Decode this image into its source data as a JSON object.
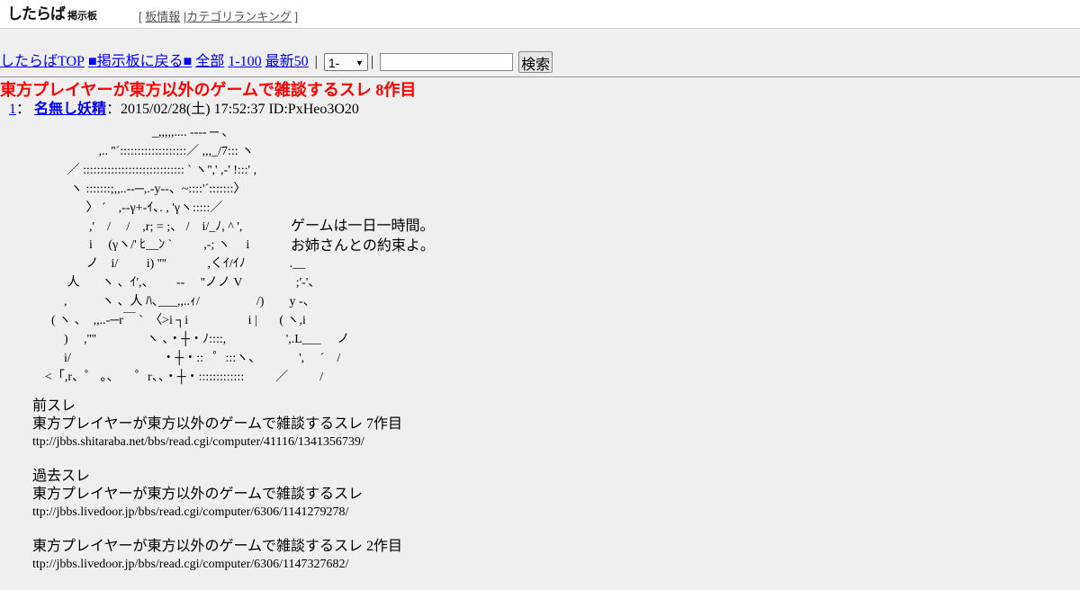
{
  "header": {
    "logo_main": "したらば",
    "logo_small": "掲示板",
    "bracket_open": "[",
    "bracket_close": "]",
    "link_board_info": "板情報",
    "divider": "|",
    "link_category_ranking": "カテゴリランキング"
  },
  "nav": {
    "top_link": "したらばTOP",
    "back_link": "■掲示板に戻る■",
    "all_link": "全部",
    "range_link": "1-100",
    "latest_link": "最新50",
    "pipe": "|",
    "select_value": "1-",
    "search_button": "検索"
  },
  "thread": {
    "title": "東方プレイヤーが東方以外のゲームで雑談するスレ 8作目"
  },
  "post": {
    "number": "1",
    "colon": "：",
    "name": "名無し妖精",
    "meta": "：2015/02/28(土) 17:52:37 ID:PxHeo3O20",
    "aa_lines": [
      "                                      _,,,,,.... ---- ─ ､",
      "                     ,.. ''´:::::::::::::::::::／ ,,,_/7::: ヽ",
      "           ／ ::::::::::::::::::::::::::::: ` ヽ'',' ,-' !:::' ,",
      "            ヽ :::::::;,,..--─,.-y--、~::::'´:::::::〉",
      "                 〉 ´    ,-‐γ+‐ｲ､. , 'γヽ:::::／",
      "                  ,'    /     /    ,r; = ;、 /    i/_ﾉ, ^ ',",
      "                  i     (γヽ/' ﾋ__ﾝ `          ,-; ヽ     i",
      "                 ノ    i/         i) ''''             ,くｲ/ｲﾉ              .__",
      "           人       ヽ 、ｲ',、       ‐-     ''ノノ V                 ;'-'、",
      "          ,           ヽ 、人 ﾊ､___,,..ｨ/                  /)        y -、",
      "      ( ヽ 、  ,,..-─r￣ `  〈>i ┐i                   i |       ( ヽ,i",
      "          )     ,''''                ヽ 、・┼・ﾉ::::,                   ',.L___     ノ",
      "          i/                             ・┼・::   ゜:::ヽ、            ',     ´    /",
      "    <「,r、゜ 。、     ゜r、、・┼・:::::::::::::          ／          /"
    ],
    "aa_text_1": "ゲームは一日一時間。",
    "aa_text_2": "お姉さんとの約束よ。",
    "blocks": [
      {
        "label": "前スレ",
        "title": "東方プレイヤーが東方以外のゲームで雑談するスレ 7作目",
        "url": "ttp://jbbs.shitaraba.net/bbs/read.cgi/computer/41116/1341356739/"
      },
      {
        "label": "過去スレ",
        "title": "東方プレイヤーが東方以外のゲームで雑談するスレ",
        "url": "ttp://jbbs.livedoor.jp/bbs/read.cgi/computer/6306/1141279278/"
      },
      {
        "label": "",
        "title": "東方プレイヤーが東方以外のゲームで雑談するスレ 2作目",
        "url": "ttp://jbbs.livedoor.jp/bbs/read.cgi/computer/6306/1147327682/"
      }
    ]
  },
  "colors": {
    "title_red": "#ff0000",
    "link_blue": "#0000ee",
    "background": "#efefef"
  }
}
